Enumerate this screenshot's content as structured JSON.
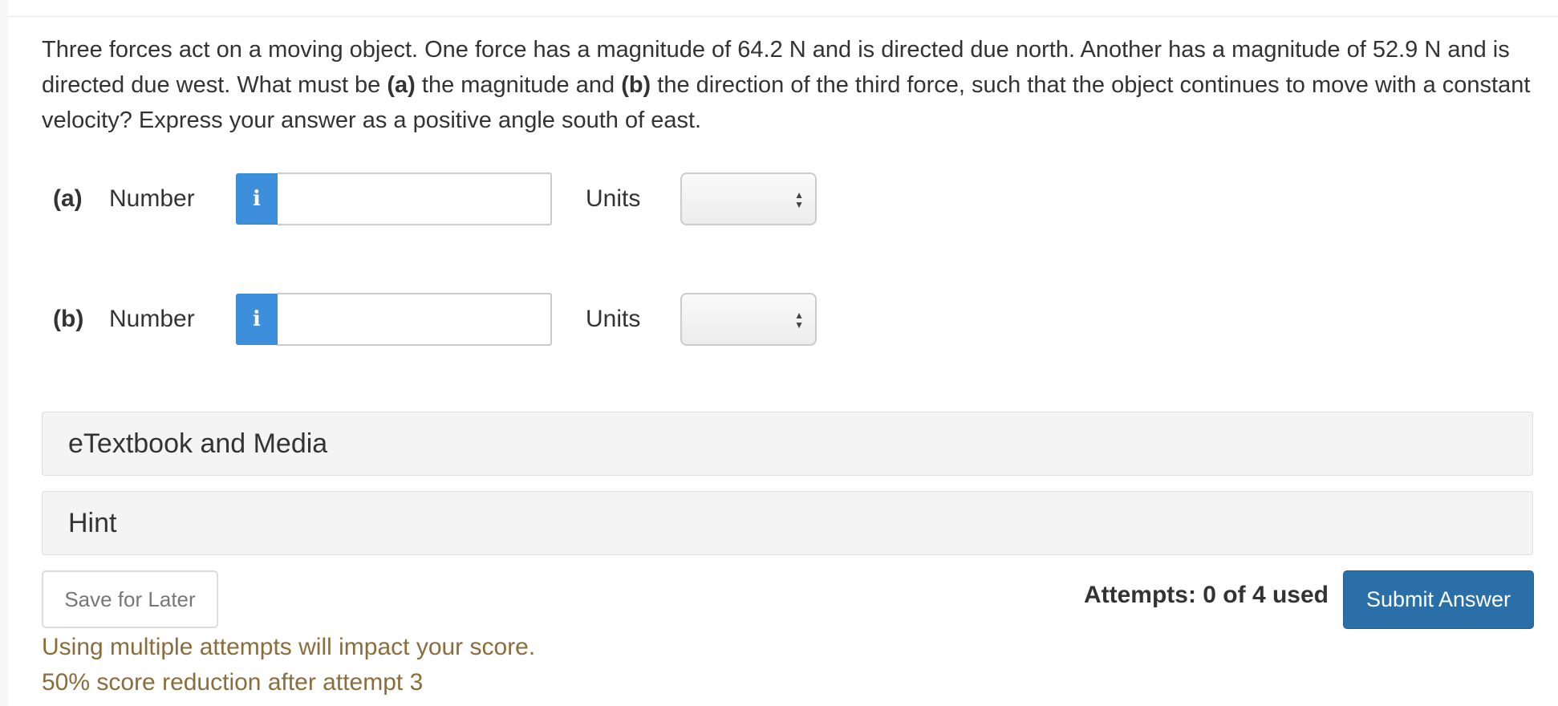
{
  "question": {
    "p1": "Three forces act on a moving object. One force has a magnitude of 64.2 N and is directed due north. Another has a magnitude of 52.9 N and is directed due west. What must be ",
    "a_tag": "(a)",
    "p2": " the magnitude and ",
    "b_tag": "(b)",
    "p3": " the direction of the third force, such that the object continues to move with a constant velocity? Express your answer as a positive angle south of east."
  },
  "answers": [
    {
      "part": "(a)",
      "number_label": "Number",
      "info_icon": "i",
      "number_value": "",
      "units_label": "Units",
      "units_selected": ""
    },
    {
      "part": "(b)",
      "number_label": "Number",
      "info_icon": "i",
      "number_value": "",
      "units_label": "Units",
      "units_selected": ""
    }
  ],
  "panels": {
    "media": "eTextbook and Media",
    "hint": "Hint"
  },
  "footer": {
    "save_label": "Save for Later",
    "attempts": "Attempts: 0 of 4 used",
    "submit_label": "Submit Answer",
    "warning_line1": "Using multiple attempts will impact your score.",
    "warning_line2": "50% score reduction after attempt 3"
  },
  "colors": {
    "info_button": "#3d8fdc",
    "submit_button": "#2a6fa8",
    "warning_text": "#8a6d3b"
  },
  "icons": {
    "info": "info-icon",
    "select": "select-arrows-icon"
  }
}
